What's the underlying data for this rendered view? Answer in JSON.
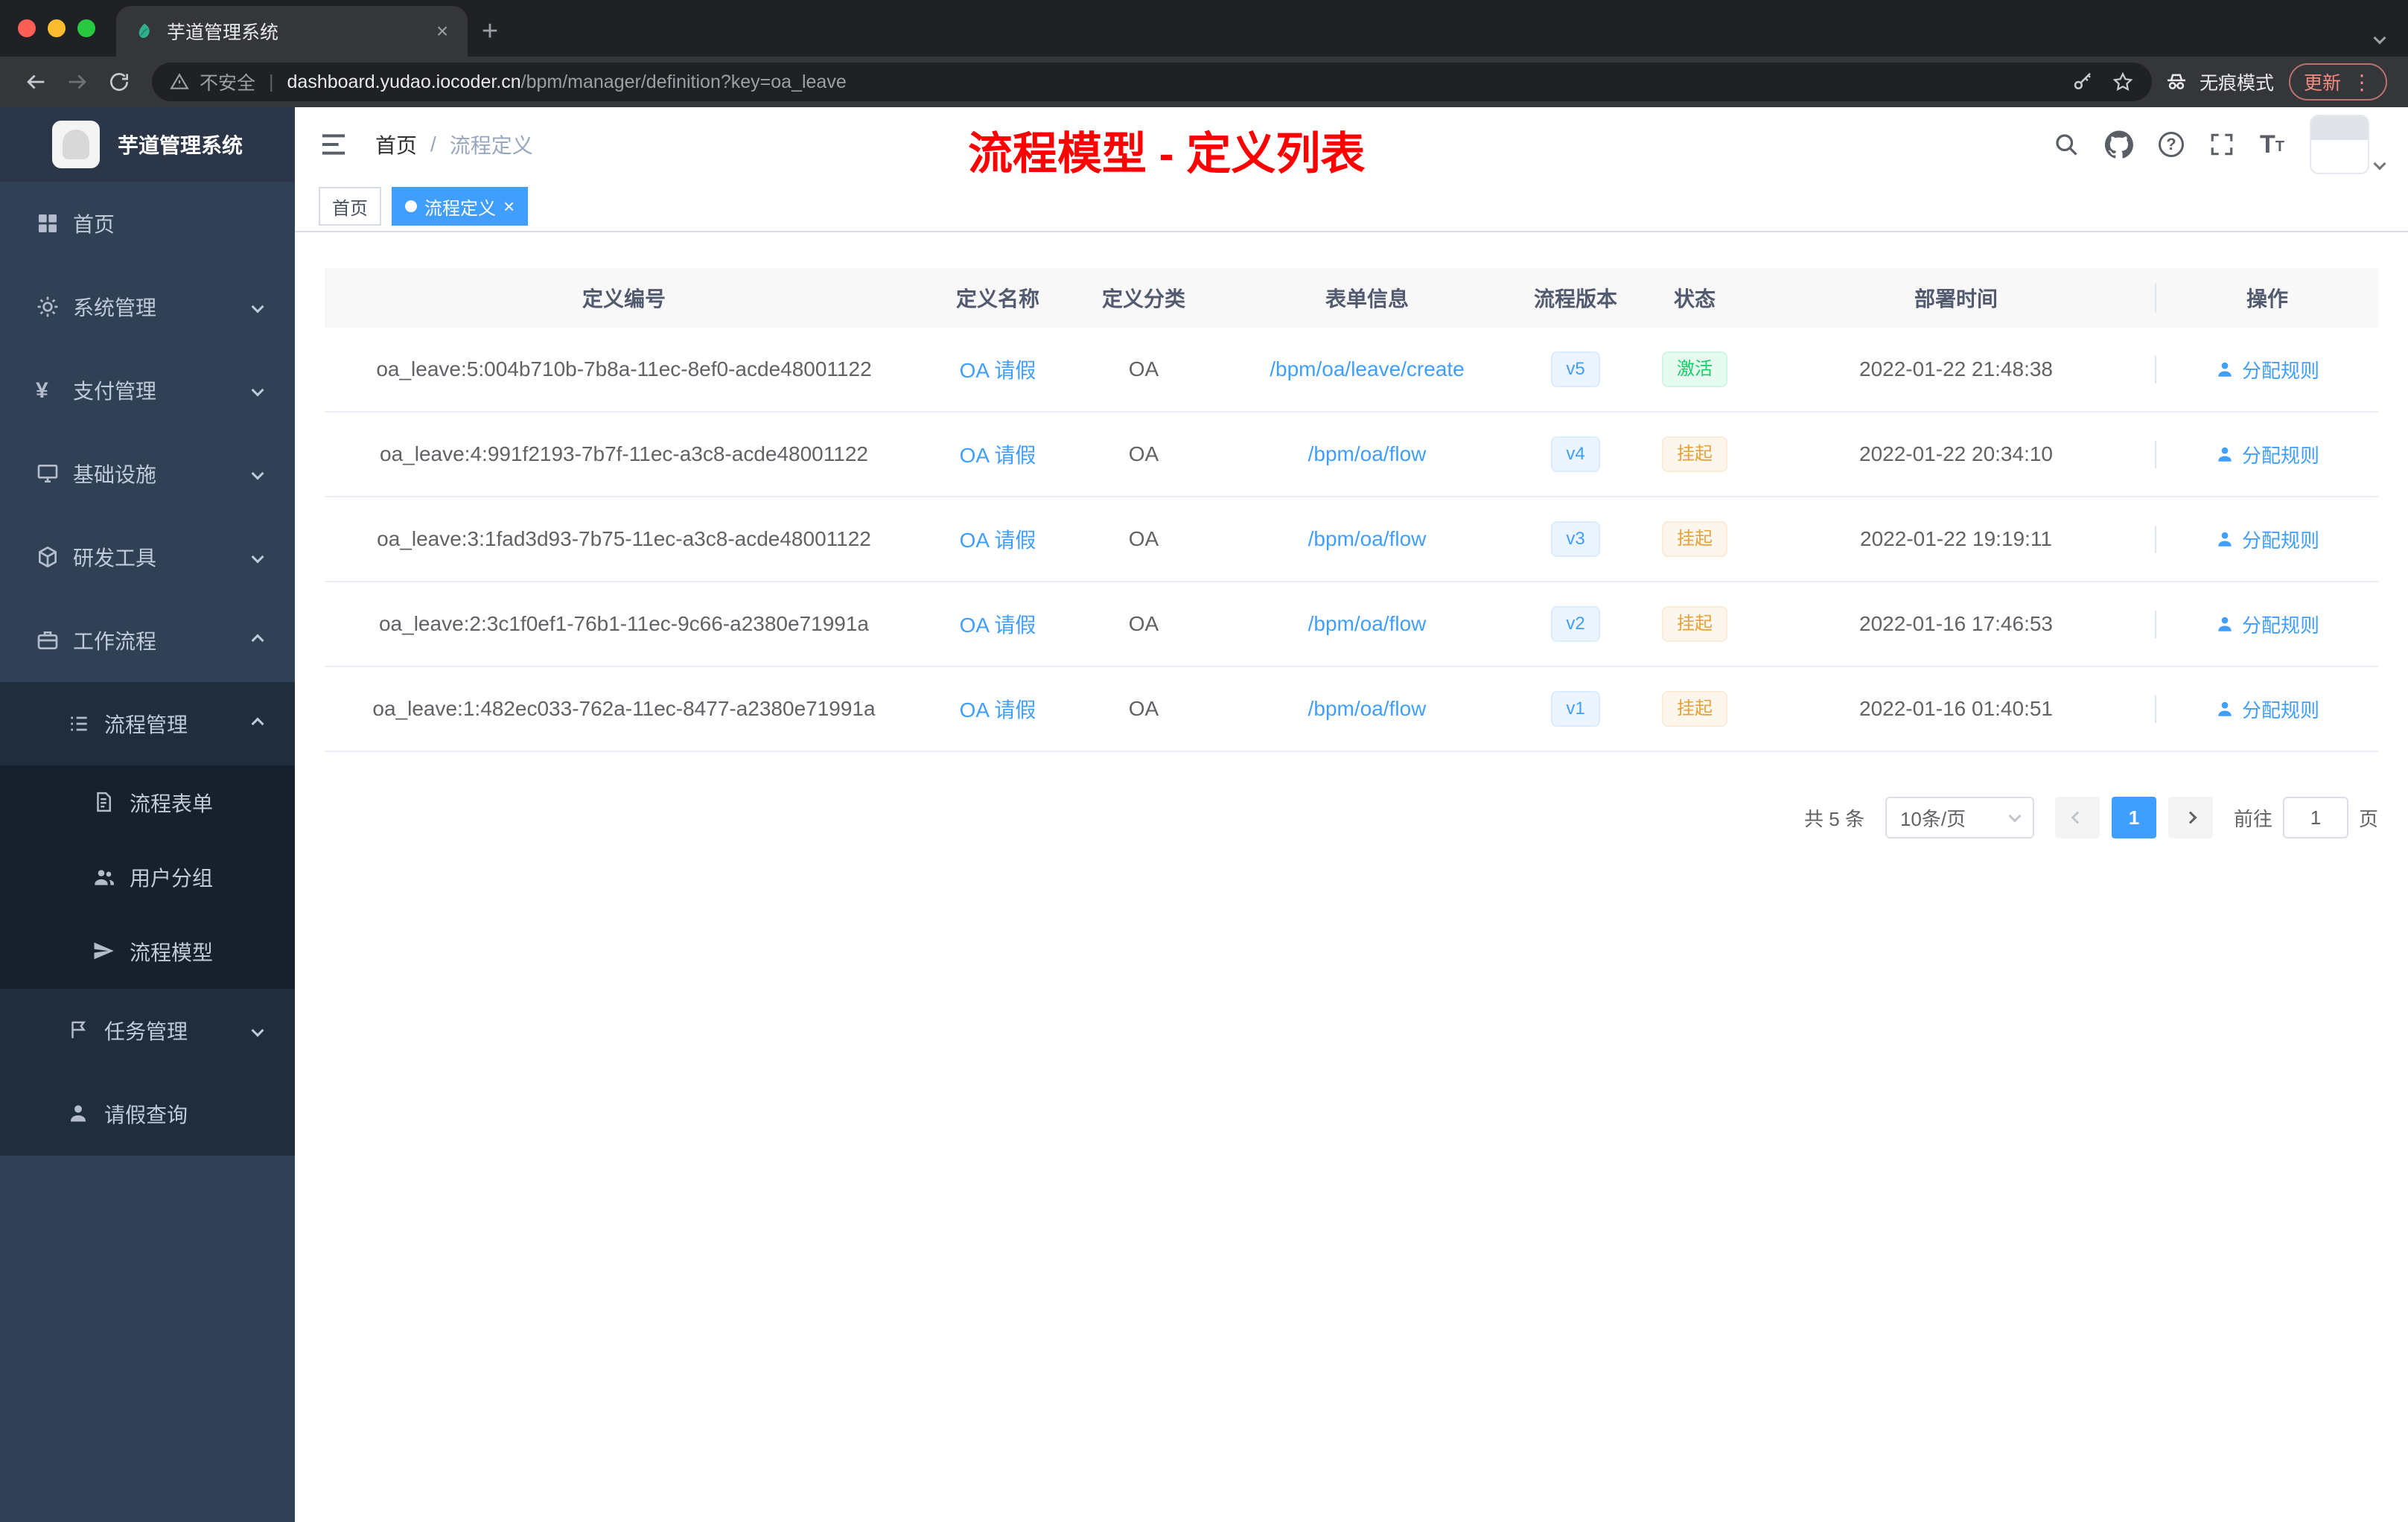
{
  "browser": {
    "tab_title": "芋道管理系统",
    "security_label": "不安全",
    "url_host": "dashboard.yudao.iocoder.cn",
    "url_path": "/bpm/manager/definition?key=oa_leave",
    "incognito_label": "无痕模式",
    "update_label": "更新"
  },
  "icons": {
    "yen": "¥",
    "kebab": "⋮",
    "question": "?",
    "close": "×",
    "plus": "+",
    "font_big": "T",
    "font_small": "T"
  },
  "sidebar": {
    "app_title": "芋道管理系统",
    "items": [
      {
        "label": "首页",
        "icon": "dashboard-icon",
        "level": 1
      },
      {
        "label": "系统管理",
        "icon": "gear-icon",
        "level": 1,
        "chevron": "down"
      },
      {
        "label": "支付管理",
        "icon": "yen-icon",
        "level": 1,
        "chevron": "down"
      },
      {
        "label": "基础设施",
        "icon": "infrastructure-icon",
        "level": 1,
        "chevron": "down"
      },
      {
        "label": "研发工具",
        "icon": "dev-tools-icon",
        "level": 1,
        "chevron": "down"
      },
      {
        "label": "工作流程",
        "icon": "workflow-icon",
        "level": 1,
        "chevron": "up"
      },
      {
        "label": "流程管理",
        "icon": "process-list-icon",
        "level": 2,
        "chevron": "up"
      },
      {
        "label": "流程表单",
        "icon": "form-icon",
        "level": 3
      },
      {
        "label": "用户分组",
        "icon": "user-group-icon",
        "level": 3
      },
      {
        "label": "流程模型",
        "icon": "send-icon",
        "level": 3
      },
      {
        "label": "任务管理",
        "icon": "task-icon",
        "level": 2,
        "chevron": "down"
      },
      {
        "label": "请假查询",
        "icon": "person-icon",
        "level": 2
      }
    ]
  },
  "header": {
    "breadcrumb_home": "首页",
    "breadcrumb_sep": "/",
    "breadcrumb_current": "流程定义",
    "annotation": "流程模型 - 定义列表"
  },
  "tags": {
    "home": "首页",
    "current": "流程定义"
  },
  "table": {
    "columns": [
      "定义编号",
      "定义名称",
      "定义分类",
      "表单信息",
      "流程版本",
      "状态",
      "部署时间",
      "操作"
    ],
    "rows": [
      {
        "id": "oa_leave:5:004b710b-7b8a-11ec-8ef0-acde48001122",
        "name": "OA 请假",
        "category": "OA",
        "form": "/bpm/oa/leave/create",
        "version": "v5",
        "status": "激活",
        "time": "2022-01-22 21:48:38",
        "action": "分配规则"
      },
      {
        "id": "oa_leave:4:991f2193-7b7f-11ec-a3c8-acde48001122",
        "name": "OA 请假",
        "category": "OA",
        "form": "/bpm/oa/flow",
        "version": "v4",
        "status": "挂起",
        "time": "2022-01-22 20:34:10",
        "action": "分配规则"
      },
      {
        "id": "oa_leave:3:1fad3d93-7b75-11ec-a3c8-acde48001122",
        "name": "OA 请假",
        "category": "OA",
        "form": "/bpm/oa/flow",
        "version": "v3",
        "status": "挂起",
        "time": "2022-01-22 19:19:11",
        "action": "分配规则"
      },
      {
        "id": "oa_leave:2:3c1f0ef1-76b1-11ec-9c66-a2380e71991a",
        "name": "OA 请假",
        "category": "OA",
        "form": "/bpm/oa/flow",
        "version": "v2",
        "status": "挂起",
        "time": "2022-01-16 17:46:53",
        "action": "分配规则"
      },
      {
        "id": "oa_leave:1:482ec033-762a-11ec-8477-a2380e71991a",
        "name": "OA 请假",
        "category": "OA",
        "form": "/bpm/oa/flow",
        "version": "v1",
        "status": "挂起",
        "time": "2022-01-16 01:40:51",
        "action": "分配规则"
      }
    ]
  },
  "pagination": {
    "total": "共 5 条",
    "page_size": "10条/页",
    "page": "1",
    "goto_label": "前往",
    "goto_value": "1",
    "unit_label": "页"
  },
  "colors": {
    "accent": "#409eff",
    "success": "#13ce66",
    "warning": "#e6a23c",
    "annotation_red": "#fe0000",
    "sidebar_bg": "#304156",
    "submenu_bg": "#1f2d3d",
    "chrome_dark": "#202124",
    "chrome_toolbar": "#35363a"
  }
}
